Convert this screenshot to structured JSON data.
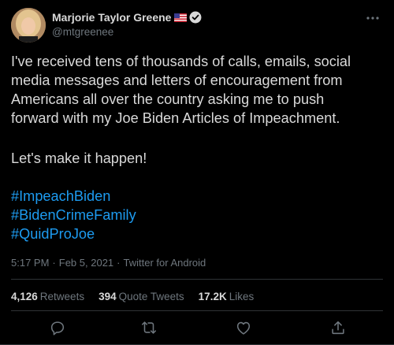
{
  "tweet": {
    "author": {
      "display_name": "Marjorie Taylor Greene",
      "handle": "@mtgreenee",
      "flag_icon": "us-flag-icon",
      "verified_icon": "verified-badge-icon"
    },
    "text_paragraph_1": "I've received tens of thousands of calls, emails, social\nmedia messages and letters of encouragement from\nAmericans all over the country asking me to push\nforward with my Joe Biden Articles of Impeachment.",
    "text_paragraph_2": "Let's make it happen!",
    "hashtags": [
      "#ImpeachBiden",
      "#BidenCrimeFamily",
      "#QuidProJoe"
    ],
    "meta": {
      "time": "5:17 PM",
      "date": "Feb 5, 2021",
      "source": "Twitter for Android",
      "separator": "·"
    },
    "stats": {
      "retweets_count": "4,126",
      "retweets_label": "Retweets",
      "quotes_count": "394",
      "quotes_label": "Quote Tweets",
      "likes_count": "17.2K",
      "likes_label": "Likes"
    },
    "actions": [
      "reply-icon",
      "retweet-icon",
      "like-icon",
      "share-icon"
    ]
  },
  "colors": {
    "background": "#000000",
    "text": "#d9d9d9",
    "muted": "#6e767d",
    "link": "#1d9bf0",
    "divider": "#2f3336"
  }
}
